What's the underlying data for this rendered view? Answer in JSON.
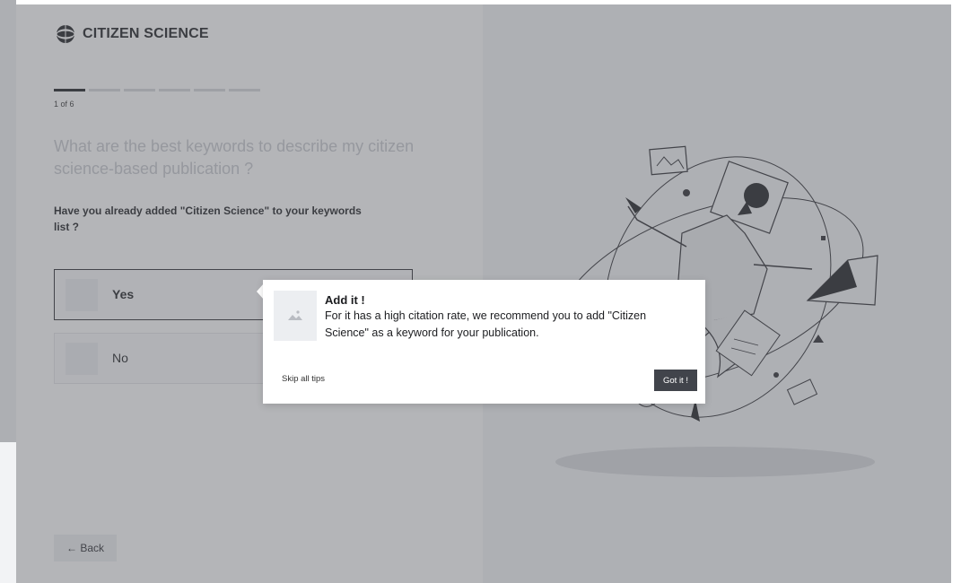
{
  "brand": {
    "name": "CITIZEN SCIENCE"
  },
  "progress": {
    "current": 1,
    "total": 6,
    "label": "1 of 6"
  },
  "question": {
    "title": "What are the best keywords to describe my citizen science-based publication ?",
    "prompt": "Have you already added \"Citizen Science\" to your keywords list ?"
  },
  "options": [
    {
      "label": "Yes",
      "selected": true
    },
    {
      "label": "No",
      "selected": false
    }
  ],
  "nav": {
    "back_label": "← Back"
  },
  "tip": {
    "title": "Add it !",
    "body": "For it has a high citation rate, we recommend you to add \"Citizen Science\" as a keyword for your publication.",
    "skip_label": "Skip all tips",
    "confirm_label": "Got it !"
  },
  "icons": {
    "logo": "globe-logo-icon",
    "tip_image": "image-placeholder-icon"
  },
  "colors": {
    "primary": "#1c1d20",
    "overlay": "#606268",
    "button_dark": "#41444b"
  }
}
